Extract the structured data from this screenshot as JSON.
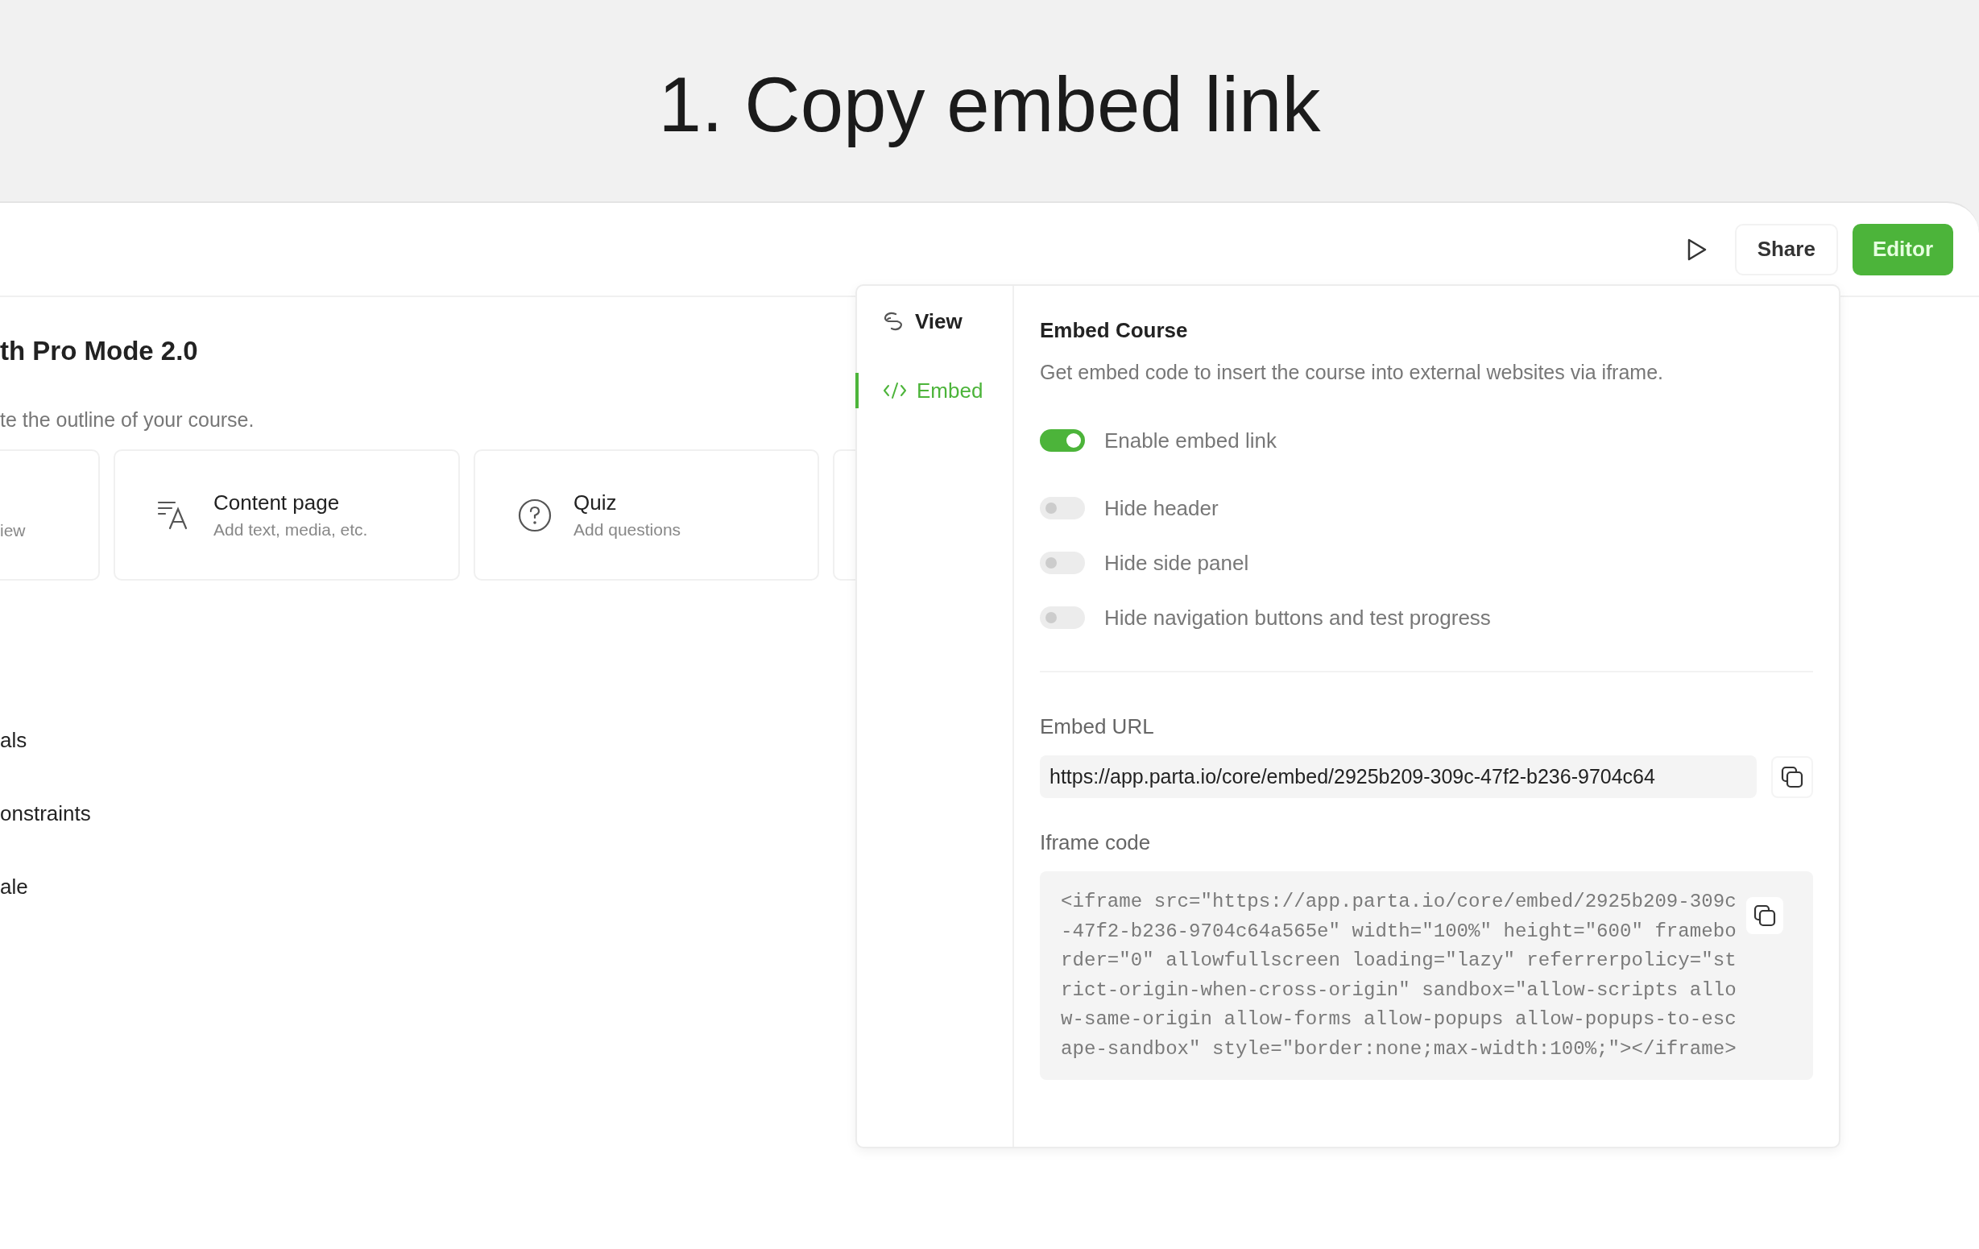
{
  "heading": "1. Copy embed link",
  "header": {
    "share": "Share",
    "editor": "Editor"
  },
  "course": {
    "title": "th Pro Mode 2.0",
    "subtitle": "te the outline of your course.",
    "cards": [
      {
        "kind": "cut",
        "description": "iew"
      },
      {
        "kind": "content",
        "title": "Content page",
        "description": "Add text, media, etc."
      },
      {
        "kind": "quiz",
        "title": "Quiz",
        "description": "Add questions"
      },
      {
        "kind": "hidden"
      }
    ],
    "outline": [
      "als",
      "onstraints",
      "ale"
    ]
  },
  "popup": {
    "nav": [
      {
        "kind": "view",
        "label": "View",
        "selected": false
      },
      {
        "kind": "embed",
        "label": "Embed",
        "selected": true
      }
    ],
    "title": "Embed Course",
    "description": "Get embed code to insert the course into external websites via iframe.",
    "toggles": [
      {
        "label": "Enable embed link",
        "on": true
      },
      {
        "label": "Hide header",
        "on": false
      },
      {
        "label": "Hide side panel",
        "on": false
      },
      {
        "label": "Hide navigation buttons and test progress",
        "on": false
      }
    ],
    "url_label": "Embed URL",
    "url": "https://app.parta.io/core/embed/2925b209-309c-47f2-b236-9704c64",
    "iframe_label": "Iframe code",
    "iframe_code": "<iframe src=\"https://app.parta.io/core/embed/2925b209-309c-47f2-b236-9704c64a565e\" width=\"100%\" height=\"600\" frameborder=\"0\" allowfullscreen loading=\"lazy\" referrerpolicy=\"strict-origin-when-cross-origin\" sandbox=\"allow-scripts allow-same-origin allow-forms allow-popups allow-popups-to-escape-sandbox\" style=\"border:none;max-width:100%;\"></iframe>"
  }
}
